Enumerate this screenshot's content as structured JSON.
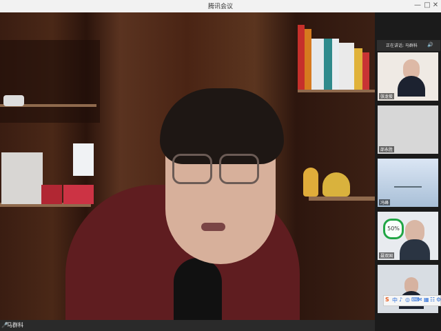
{
  "window": {
    "title": "腾讯会议",
    "min_glyph": "—",
    "restore_glyph": "□",
    "close_glyph": "✕"
  },
  "main_video": {
    "name": "马群科"
  },
  "sidebar": {
    "header": "正在讲话: 马群科",
    "header_icon": "speaker-icon",
    "thumbnails": [
      {
        "name": "张龙俊"
      },
      {
        "name": "邵永胜"
      },
      {
        "name": "冯峰"
      },
      {
        "name": "聂双国",
        "badge": "50%"
      },
      {
        "name": ""
      }
    ]
  },
  "toolbar_icons": [
    "S",
    "中",
    "♪",
    "◎",
    "⌨",
    "✉",
    "▦",
    "☷",
    "⚙"
  ]
}
